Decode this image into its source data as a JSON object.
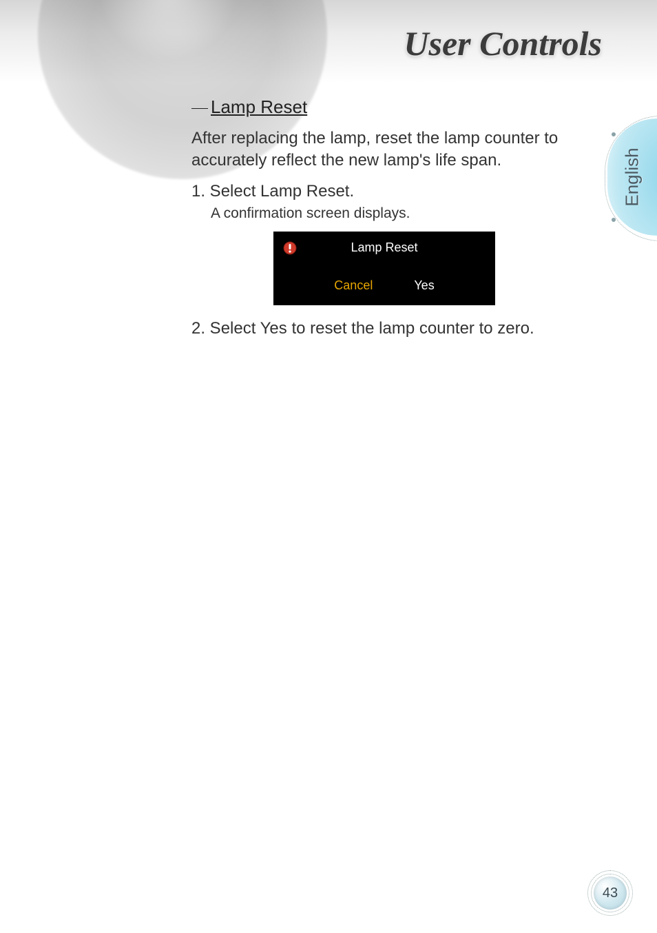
{
  "page": {
    "title": "User Controls",
    "language": "English",
    "number": "43"
  },
  "section": {
    "heading": "Lamp Reset",
    "intro": "After replacing the lamp, reset the lamp counter to accurately reflect the new lamp's life span.",
    "step1": "1. Select Lamp Reset.",
    "step1_sub": "A confirmation screen displays.",
    "step2": "2. Select Yes to reset the lamp counter to zero."
  },
  "dialog": {
    "title": "Lamp Reset",
    "cancel": "Cancel",
    "yes": "Yes"
  }
}
